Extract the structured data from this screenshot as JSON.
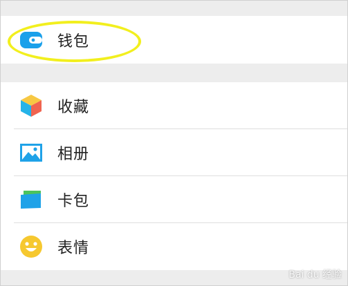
{
  "groups": [
    {
      "items": [
        {
          "label": "钱包",
          "icon": "wallet-icon"
        }
      ]
    },
    {
      "items": [
        {
          "label": "收藏",
          "icon": "favorites-cube-icon"
        },
        {
          "label": "相册",
          "icon": "album-picture-icon"
        },
        {
          "label": "卡包",
          "icon": "card-package-icon"
        },
        {
          "label": "表情",
          "icon": "smiley-icon"
        }
      ]
    }
  ],
  "colors": {
    "accent_blue": "#1aa0ea",
    "highlight_yellow": "#f2ef1e",
    "background": "#ededed",
    "row_background": "#ffffff"
  },
  "watermark": "Bai du 经验"
}
